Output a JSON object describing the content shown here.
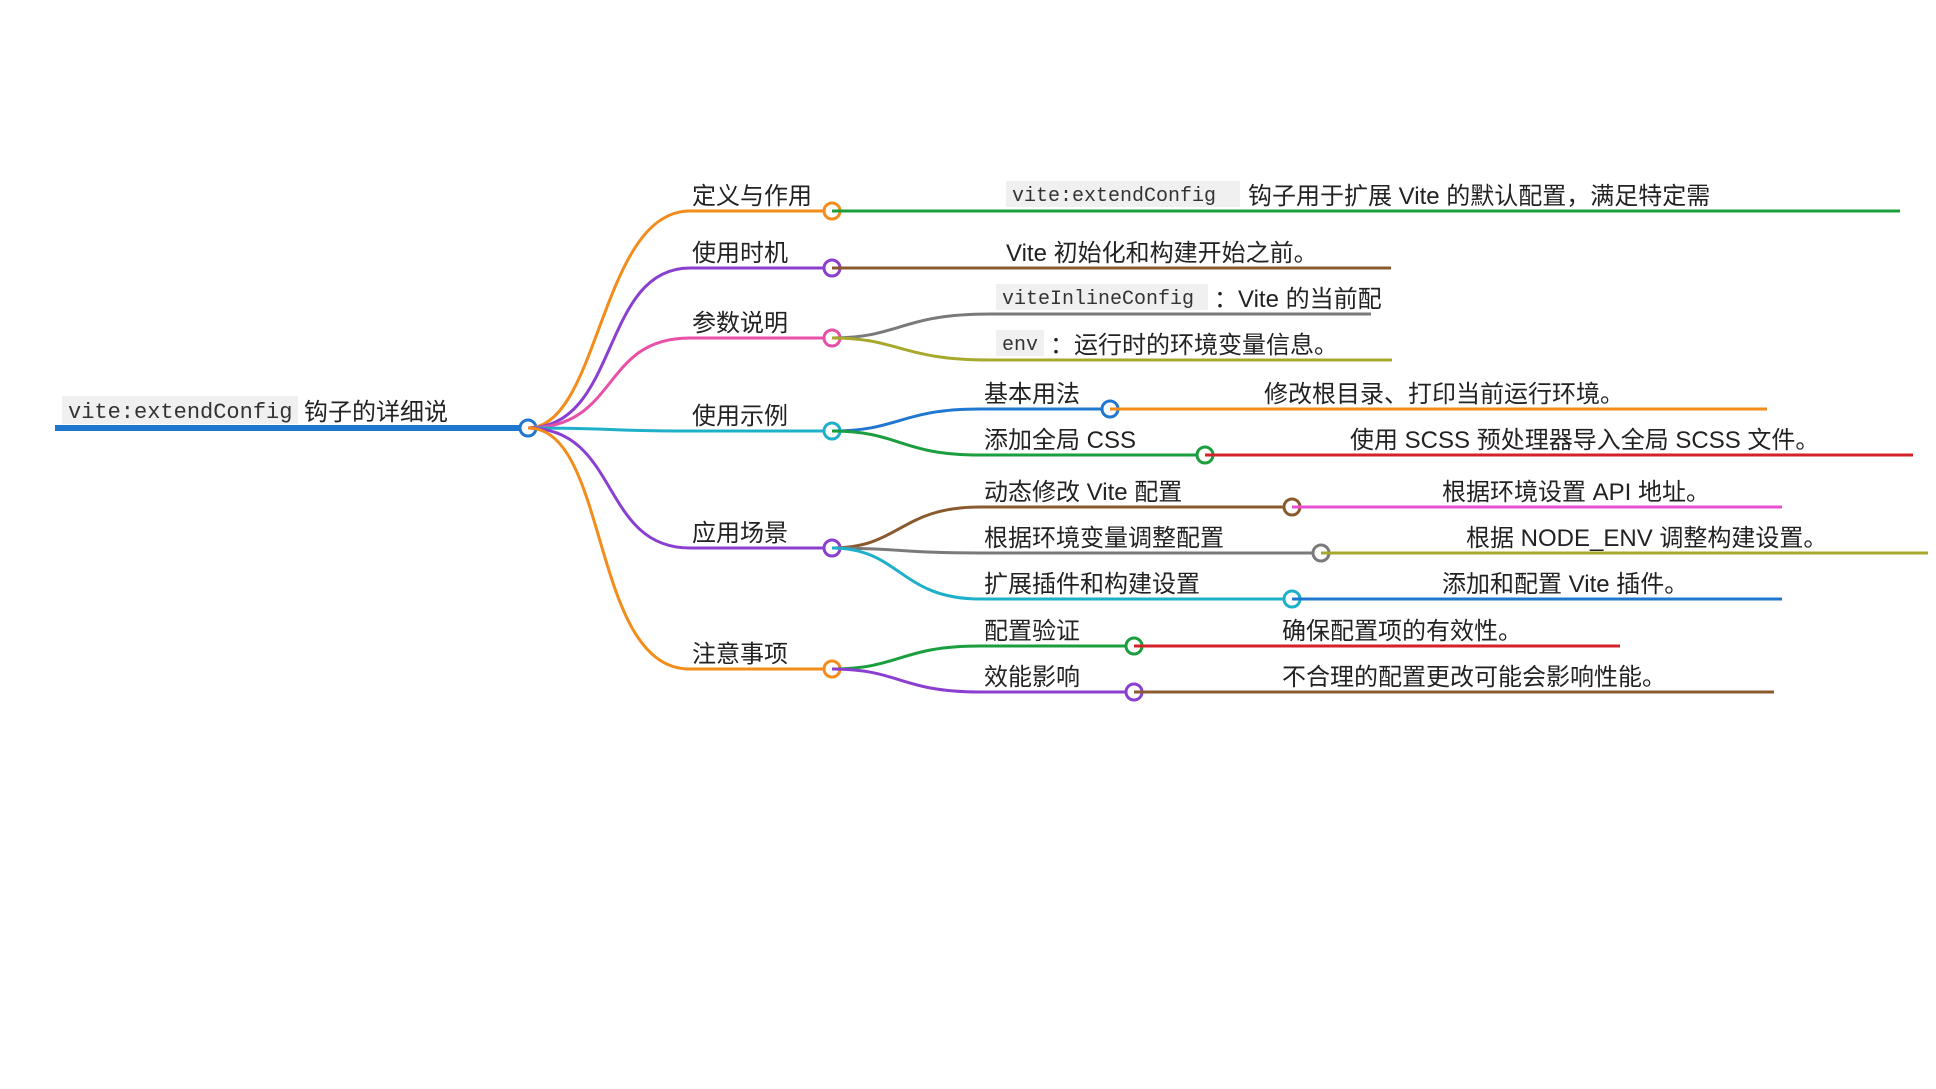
{
  "root": {
    "code": "vite:extendConfig",
    "label_suffix": " 钩子的详细说"
  },
  "b1": {
    "label": "定义与作用",
    "leaf_code": "vite:extendConfig",
    "leaf_text": " 钩子用于扩展 Vite 的默认配置，满足特定需"
  },
  "b2": {
    "label": "使用时机",
    "leaf_text": "Vite 初始化和构建开始之前。"
  },
  "b3": {
    "label": "参数说明",
    "leaf1_code": "viteInlineConfig",
    "leaf1_text": "：Vite 的当前配",
    "leaf2_code": "env",
    "leaf2_text": "：运行时的环境变量信息。"
  },
  "b4": {
    "label": "使用示例",
    "c1": {
      "label": "基本用法",
      "leaf": "修改根目录、打印当前运行环境。"
    },
    "c2": {
      "label": "添加全局 CSS",
      "leaf": "使用 SCSS 预处理器导入全局 SCSS 文件。"
    }
  },
  "b5": {
    "label": "应用场景",
    "c1": {
      "label": "动态修改 Vite 配置",
      "leaf": "根据环境设置 API 地址。"
    },
    "c2": {
      "label": "根据环境变量调整配置",
      "leaf": "根据 NODE_ENV 调整构建设置。"
    },
    "c3": {
      "label": "扩展插件和构建设置",
      "leaf": "添加和配置 Vite 插件。"
    }
  },
  "b6": {
    "label": "注意事项",
    "c1": {
      "label": "配置验证",
      "leaf": "确保配置项的有效性。"
    },
    "c2": {
      "label": "效能影响",
      "leaf": "不合理的配置更改可能会影响性能。"
    }
  },
  "colors": {
    "root": "#1f77d0",
    "orange": "#f28c1b",
    "purple": "#8a3fd1",
    "pink": "#e84fa7",
    "teal": "#1fb0c9",
    "brown": "#8a5a2e",
    "green": "#1a9e3e",
    "gray": "#7a7a7a",
    "olive": "#a8a82d",
    "blue": "#1f77d0",
    "red": "#d4222a",
    "magenta": "#e84fd1",
    "cyan": "#1fb0c9"
  }
}
